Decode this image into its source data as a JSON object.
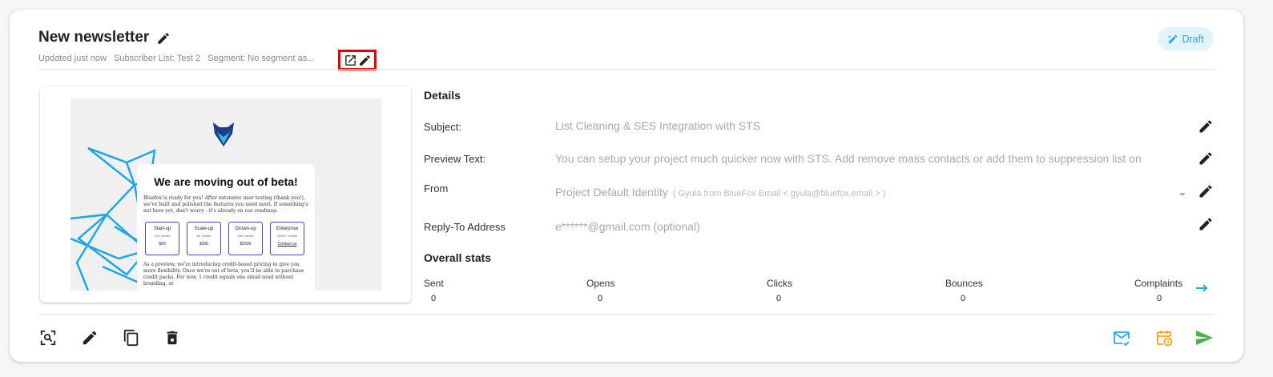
{
  "header": {
    "title": "New newsletter",
    "meta": {
      "updated": "Updated just now",
      "subscriber_list": "Subscriber List: Test 2",
      "segment": "Segment: No segment as..."
    },
    "status_badge": "Draft"
  },
  "preview": {
    "heading": "We are moving out of beta!",
    "intro": "Bluefox is ready for you! After extensive user testing (thank you!), we've built and polished the features you need most. If something's not here yet, don't worry - it's already on our roadmap.",
    "tiers": [
      {
        "name": "Start-up",
        "credits": "10K credits",
        "price": "$50"
      },
      {
        "name": "Scale-up",
        "credits": "5K credits",
        "price": "$300"
      },
      {
        "name": "Grown-up",
        "credits": "50K credits",
        "price": "$2500"
      },
      {
        "name": "Enterprise",
        "credits": "100K+ credits",
        "price": "Contact us"
      }
    ],
    "outro": "As a preview, we're introducing credit-based pricing to give you more flexibility. Once we're out of beta, you'll be able to purchase credit packs. For now, 1 credit equals one email send without branding, or"
  },
  "details": {
    "section_title": "Details",
    "subject": {
      "label": "Subject:",
      "value": "List Cleaning & SES Integration with STS"
    },
    "preview_text": {
      "label": "Preview Text:",
      "value": "You can setup your project much quicker now with STS. Add remove mass contacts or add them to suppression list on"
    },
    "from": {
      "label": "From",
      "value": "Project Default Identity",
      "identity": "( Gyula from BlueFox Email < gyula@bluefox.email > )"
    },
    "reply_to": {
      "label": "Reply-To Address",
      "placeholder": "e******@gmail.com (optional)"
    }
  },
  "stats": {
    "section_title": "Overall stats",
    "items": [
      {
        "label": "Sent",
        "value": "0"
      },
      {
        "label": "Opens",
        "value": "0"
      },
      {
        "label": "Clicks",
        "value": "0"
      },
      {
        "label": "Bounces",
        "value": "0"
      },
      {
        "label": "Complaints",
        "value": "0"
      }
    ]
  },
  "colors": {
    "accent": "#29a8e0",
    "badge_bg": "#e3f3fc",
    "highlight": "#e00000",
    "schedule_orange": "#f5a623",
    "send_green": "#4caf50"
  },
  "icons": {
    "title_edit": "pencil-icon",
    "open_external": "open-in-new-icon",
    "meta_edit": "pencil-icon",
    "draft": "draft-icon",
    "toolbar": [
      "preview-zoom-icon",
      "edit-pencil-icon",
      "duplicate-icon",
      "delete-icon",
      "test-email-icon",
      "schedule-icon",
      "send-icon"
    ]
  }
}
